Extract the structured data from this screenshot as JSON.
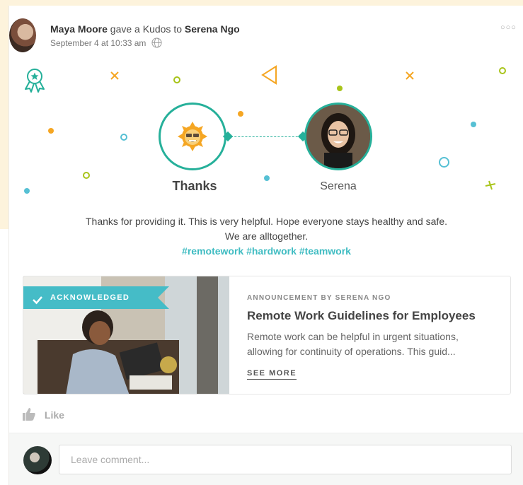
{
  "post": {
    "author": "Maya Moore",
    "action_text": " gave a Kudos to ",
    "recipient": "Serena Ngo",
    "timestamp": "September 4 at 10:33 am"
  },
  "kudos": {
    "badge_label": "Thanks",
    "recipient_label": "Serena"
  },
  "message": {
    "line1": "Thanks for providing it. This is very helpful. Hope everyone stays healthy and safe.",
    "line2": "We are alltogether.",
    "hashtags": [
      "#remotework",
      "#hardwork",
      "#teamwork"
    ]
  },
  "announcement": {
    "badge": "ACKNOWLEDGED",
    "kicker": "ANNOUNCEMENT BY SERENA NGO",
    "title": "Remote Work Guidelines for Employees",
    "description": "Remote work can be helpful in urgent situations, allowing for continuity of operations.  This guid...",
    "see_more": "SEE MORE"
  },
  "actions": {
    "like_label": "Like"
  },
  "comment": {
    "placeholder": "Leave comment..."
  },
  "colors": {
    "accent_teal": "#26b09a",
    "ribbon": "#45bcc7",
    "hashtag": "#3fbcc2",
    "confetti_orange": "#f5a623",
    "confetti_green": "#a8c41a",
    "confetti_blue": "#56c0d4",
    "background_cream": "#fdf3dc"
  },
  "icons": {
    "badge_top_left": "award-ribbon-icon",
    "globe": "globe-icon",
    "more": "more-dots-icon",
    "check": "check-icon",
    "like": "thumbs-up-icon",
    "kudos_badge": "sun-face-icon"
  }
}
